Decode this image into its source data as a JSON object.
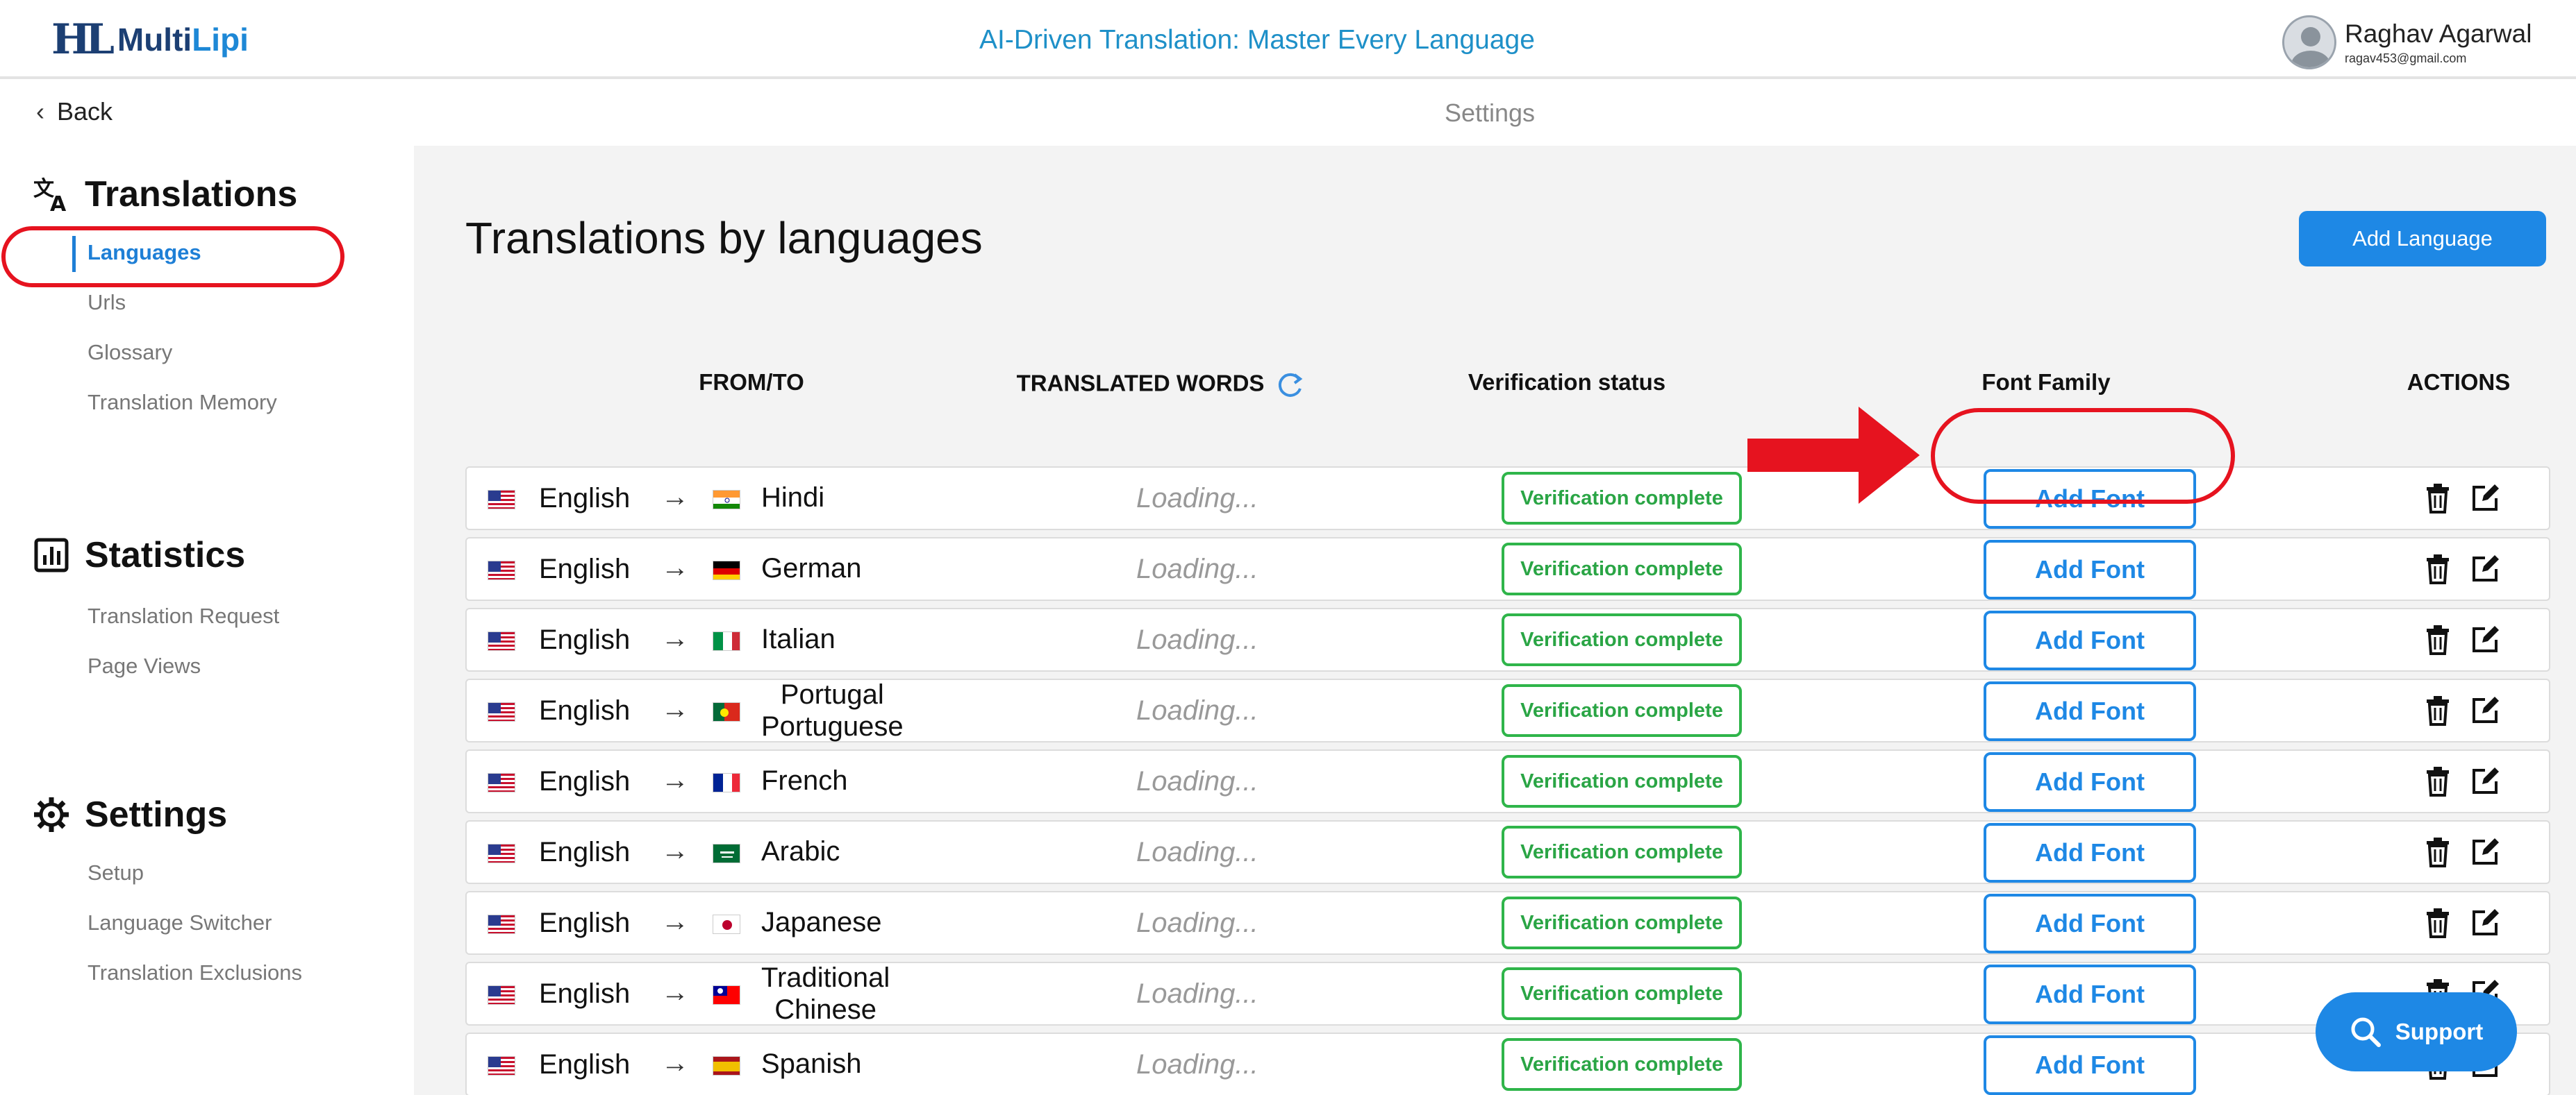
{
  "header": {
    "logo_prefix": "Multi",
    "logo_suffix": "Lipi",
    "tagline": "AI-Driven Translation: Master Every Language",
    "user_name": "Raghav Agarwal",
    "user_email": "ragav453@gmail.com"
  },
  "subbar": {
    "back_label": "Back",
    "title": "Settings"
  },
  "sidebar": {
    "sections": [
      {
        "title": "Translations",
        "icon": "translate-icon",
        "items": [
          "Languages",
          "Urls",
          "Glossary",
          "Translation Memory"
        ]
      },
      {
        "title": "Statistics",
        "icon": "bar-chart-icon",
        "items": [
          "Translation Request",
          "Page Views"
        ]
      },
      {
        "title": "Settings",
        "icon": "gear-icon",
        "items": [
          "Setup",
          "Language Switcher",
          "Translation Exclusions"
        ]
      }
    ],
    "active_item": "Languages"
  },
  "main": {
    "title": "Translations by languages",
    "add_language_label": "Add Language",
    "columns": [
      "FROM/TO",
      "TRANSLATED WORDS",
      "Verification status",
      "Font Family",
      "ACTIONS"
    ],
    "rows": [
      {
        "from": "English",
        "to": "Hindi",
        "words": "Loading...",
        "status": "Verification complete",
        "font_label": "Add Font",
        "flag": "india"
      },
      {
        "from": "English",
        "to": "German",
        "words": "Loading...",
        "status": "Verification complete",
        "font_label": "Add Font",
        "flag": "germany"
      },
      {
        "from": "English",
        "to": "Italian",
        "words": "Loading...",
        "status": "Verification complete",
        "font_label": "Add Font",
        "flag": "italy"
      },
      {
        "from": "English",
        "to_line1": "Portugal",
        "to_line2": "Portuguese",
        "words": "Loading...",
        "status": "Verification complete",
        "font_label": "Add Font",
        "flag": "portugal"
      },
      {
        "from": "English",
        "to": "French",
        "words": "Loading...",
        "status": "Verification complete",
        "font_label": "Add Font",
        "flag": "france"
      },
      {
        "from": "English",
        "to": "Arabic",
        "words": "Loading...",
        "status": "Verification complete",
        "font_label": "Add Font",
        "flag": "saudi-arabia"
      },
      {
        "from": "English",
        "to": "Japanese",
        "words": "Loading...",
        "status": "Verification complete",
        "font_label": "Add Font",
        "flag": "japan"
      },
      {
        "from": "English",
        "to_line1": "Traditional",
        "to_line2": "Chinese",
        "words": "Loading...",
        "status": "Verification complete",
        "font_label": "Add Font",
        "flag": "taiwan"
      },
      {
        "from": "English",
        "to": "Spanish",
        "words": "Loading...",
        "status": "Verification complete",
        "font_label": "Add Font",
        "flag": "spain"
      }
    ]
  },
  "support_label": "Support",
  "colors": {
    "accent": "#1e88e5",
    "success": "#2fb54a",
    "annotation": "#e6131f"
  }
}
